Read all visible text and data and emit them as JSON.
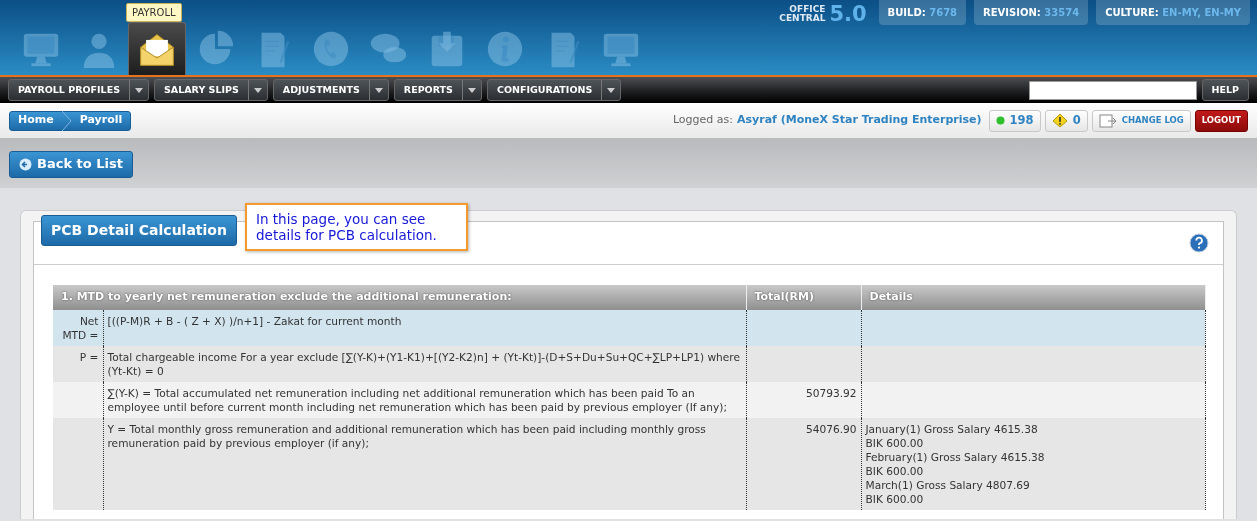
{
  "header": {
    "modules": [
      {
        "kind": "monitor",
        "selected": false
      },
      {
        "kind": "person",
        "selected": false
      },
      {
        "kind": "envelope",
        "selected": true
      },
      {
        "kind": "pie",
        "selected": false
      },
      {
        "kind": "document",
        "selected": false
      },
      {
        "kind": "phone",
        "selected": false
      },
      {
        "kind": "chat",
        "selected": false
      },
      {
        "kind": "floppy",
        "selected": false
      },
      {
        "kind": "info",
        "selected": false
      },
      {
        "kind": "document",
        "selected": false
      },
      {
        "kind": "monitor",
        "selected": false
      }
    ],
    "tooltip": "PAYROLL",
    "brand": {
      "line1": "OFFICE",
      "line2": "CENTRAL",
      "version": "5.0"
    },
    "info": [
      {
        "label": "BUILD:",
        "value": "7678"
      },
      {
        "label": "REVISION:",
        "value": "33574"
      },
      {
        "label": "CULTURE:",
        "value": "EN-MY, EN-MY"
      }
    ]
  },
  "menu": [
    {
      "label": "PAYROLL PROFILES"
    },
    {
      "label": "SALARY SLIPS"
    },
    {
      "label": "ADJUSTMENTS"
    },
    {
      "label": "REPORTS"
    },
    {
      "label": "CONFIGURATIONS"
    }
  ],
  "help": "HELP",
  "breadcrumb": [
    {
      "label": "Home"
    },
    {
      "label": "Payroll"
    }
  ],
  "user": {
    "prefix": "Logged as:",
    "name": "Asyraf (MoneX Star Trading Enterprise)"
  },
  "badges": [
    {
      "kind": "online",
      "text": "198"
    },
    {
      "kind": "warning",
      "text": "0"
    },
    {
      "kind": "changelog",
      "text": "CHANGE LOG"
    },
    {
      "kind": "logout",
      "text": "LOGOUT"
    }
  ],
  "back_button": "Back to List",
  "panel": {
    "title": "PCB Detail Calculation",
    "callout": "In this page, you can see details for PCB calculation.",
    "table": {
      "columns": [
        "1. MTD to yearly net remuneration exclude the additional remuneration:",
        "Total(RM)",
        "Details"
      ],
      "rows": [
        {
          "label": "Net MTD =",
          "formula": "[((P-M)R + B - ( Z + X) )/n+1] - Zakat for current month",
          "total": "",
          "details": [],
          "selected": true
        },
        {
          "label": "P =",
          "formula": "Total chargeable income For a year exclude [∑(Y-K)+(Y1-K1)+[(Y2-K2)n] + (Yt-Kt)]-(D+S+Du+Su+QC+∑LP+LP1) where (Yt-Kt) = 0",
          "total": "",
          "details": [],
          "selected": false
        },
        {
          "label": "",
          "formula": "∑(Y-K) = Total accumulated net remuneration including net additional remuneration which has been paid To an employee until before current month including net remuneration which has been paid by previous employer (If any);",
          "total": "50793.92",
          "details": [],
          "selected": false
        },
        {
          "label": "",
          "formula": "Y = Total monthly gross remuneration and additional remuneration which has been paid including monthly gross remuneration paid by previous employer (if any);",
          "total": "54076.90",
          "details": [
            "January(1) Gross Salary 4615.38",
            "BIK 600.00",
            "February(1) Gross Salary 4615.38",
            "BIK 600.00",
            "March(1) Gross Salary 4807.69",
            "BIK 600.00"
          ],
          "selected": false
        }
      ]
    }
  }
}
